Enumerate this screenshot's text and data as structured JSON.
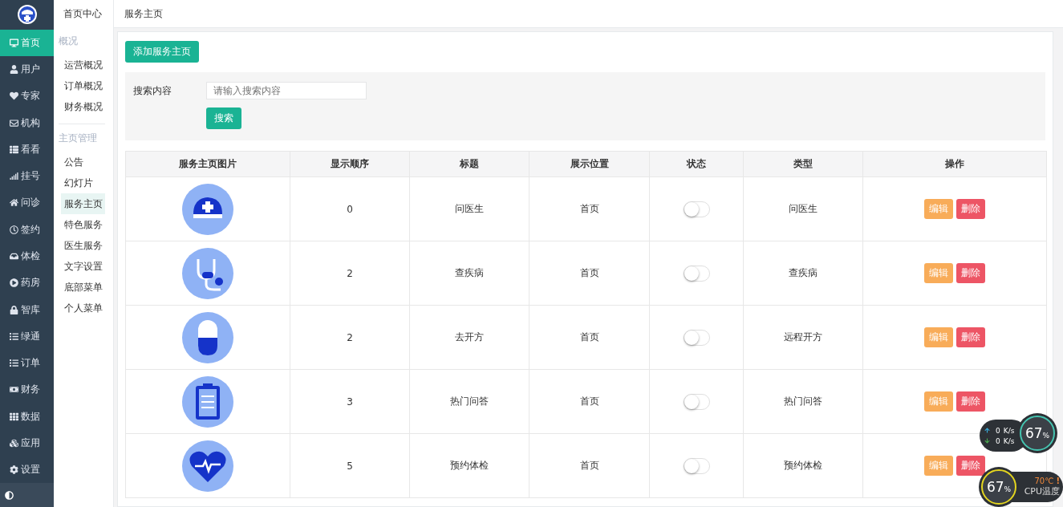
{
  "nav": [
    {
      "label": "首页",
      "selected": true
    },
    {
      "label": "用户",
      "selected": false
    },
    {
      "label": "专家",
      "selected": false
    },
    {
      "label": "机构",
      "selected": false
    },
    {
      "label": "看看",
      "selected": false
    },
    {
      "label": "挂号",
      "selected": false
    },
    {
      "label": "问诊",
      "selected": false
    },
    {
      "label": "签约",
      "selected": false
    },
    {
      "label": "体检",
      "selected": false
    },
    {
      "label": "药房",
      "selected": false
    },
    {
      "label": "智库",
      "selected": false
    },
    {
      "label": "绿通",
      "selected": false
    },
    {
      "label": "订单",
      "selected": false
    },
    {
      "label": "财务",
      "selected": false
    },
    {
      "label": "数据",
      "selected": false
    },
    {
      "label": "应用",
      "selected": false
    },
    {
      "label": "设置",
      "selected": false
    }
  ],
  "submenu": {
    "title": "首页中心",
    "groups": [
      {
        "heading": "概况",
        "items": [
          {
            "label": "运营概况",
            "selected": false
          },
          {
            "label": "订单概况",
            "selected": false
          },
          {
            "label": "财务概况",
            "selected": false
          }
        ]
      },
      {
        "heading": "主页管理",
        "items": [
          {
            "label": "公告",
            "selected": false
          },
          {
            "label": "幻灯片",
            "selected": false
          },
          {
            "label": "服务主页",
            "selected": true
          },
          {
            "label": "特色服务",
            "selected": false
          },
          {
            "label": "医生服务",
            "selected": false
          },
          {
            "label": "文字设置",
            "selected": false
          },
          {
            "label": "底部菜单",
            "selected": false
          },
          {
            "label": "个人菜单",
            "selected": false
          }
        ]
      }
    ]
  },
  "breadcrumb": "服务主页",
  "add_button": "添加服务主页",
  "search": {
    "label": "搜索内容",
    "placeholder": "请输入搜索内容",
    "button": "搜索"
  },
  "table": {
    "columns": [
      "服务主页图片",
      "显示顺序",
      "标题",
      "展示位置",
      "状态",
      "类型",
      "操作"
    ],
    "rows": [
      {
        "kind": "cap",
        "order": "0",
        "title": "问医生",
        "position": "首页",
        "on": false,
        "type": "问医生",
        "actions": [
          "编辑",
          "删除"
        ]
      },
      {
        "kind": "stethoscope",
        "order": "2",
        "title": "查疾病",
        "position": "首页",
        "on": false,
        "type": "查疾病",
        "actions": [
          "编辑",
          "删除"
        ]
      },
      {
        "kind": "pill",
        "order": "2",
        "title": "去开方",
        "position": "首页",
        "on": false,
        "type": "远程开方",
        "actions": [
          "编辑",
          "删除"
        ]
      },
      {
        "kind": "clipboard",
        "order": "3",
        "title": "热门问答",
        "position": "首页",
        "on": false,
        "type": "热门问答",
        "actions": [
          "编辑",
          "删除"
        ]
      },
      {
        "kind": "heart",
        "order": "5",
        "title": "预约体检",
        "position": "首页",
        "on": false,
        "type": "预约体检",
        "actions": [
          "编辑",
          "删除"
        ]
      }
    ]
  },
  "monitor": {
    "up": "0",
    "up_unit": "K/s",
    "down": "0",
    "down_unit": "K/s",
    "usage": "67",
    "usage_unit": "%",
    "cpu": "67",
    "cpu_unit": "%",
    "temp": "70℃",
    "alert": "!",
    "temp_label": "CPU温度"
  }
}
